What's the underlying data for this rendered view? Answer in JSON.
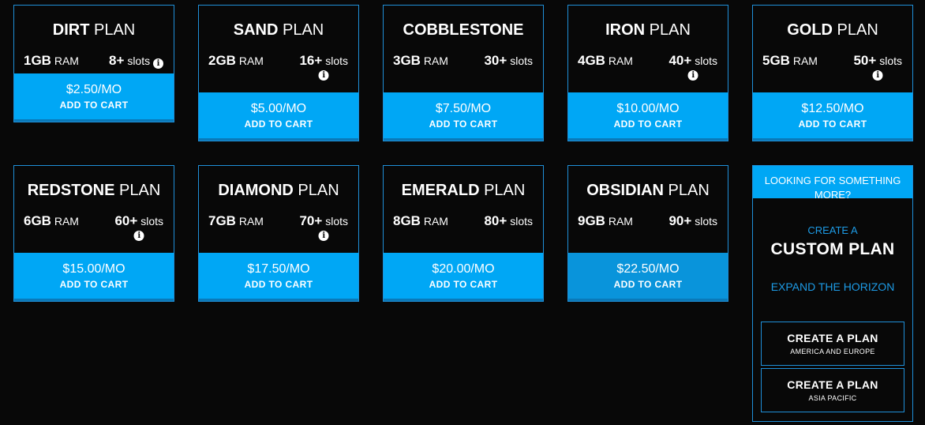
{
  "plans": [
    {
      "name_strong": "DIRT",
      "name_light": "PLAN",
      "ram_num": "1GB",
      "ram_unit": "RAM",
      "slots_num": "8+",
      "slots_unit": "slots",
      "price": "$2.50/MO",
      "cart": "ADD TO CART"
    },
    {
      "name_strong": "SAND",
      "name_light": "PLAN",
      "ram_num": "2GB",
      "ram_unit": "RAM",
      "slots_num": "16+",
      "slots_unit": "slots",
      "price": "$5.00/MO",
      "cart": "ADD TO CART"
    },
    {
      "name_strong": "COBBLESTONE",
      "name_light": "",
      "ram_num": "3GB",
      "ram_unit": "RAM",
      "slots_num": "30+",
      "slots_unit": "slots",
      "price": "$7.50/MO",
      "cart": "ADD TO CART"
    },
    {
      "name_strong": "IRON",
      "name_light": "PLAN",
      "ram_num": "4GB",
      "ram_unit": "RAM",
      "slots_num": "40+",
      "slots_unit": "slots",
      "price": "$10.00/MO",
      "cart": "ADD TO CART"
    },
    {
      "name_strong": "GOLD",
      "name_light": "PLAN",
      "ram_num": "5GB",
      "ram_unit": "RAM",
      "slots_num": "50+",
      "slots_unit": "slots",
      "price": "$12.50/MO",
      "cart": "ADD TO CART"
    },
    {
      "name_strong": "REDSTONE",
      "name_light": "PLAN",
      "ram_num": "6GB",
      "ram_unit": "RAM",
      "slots_num": "60+",
      "slots_unit": "slots",
      "price": "$15.00/MO",
      "cart": "ADD TO CART"
    },
    {
      "name_strong": "DIAMOND",
      "name_light": "PLAN",
      "ram_num": "7GB",
      "ram_unit": "RAM",
      "slots_num": "70+",
      "slots_unit": "slots",
      "price": "$17.50/MO",
      "cart": "ADD TO CART"
    },
    {
      "name_strong": "EMERALD",
      "name_light": "PLAN",
      "ram_num": "8GB",
      "ram_unit": "RAM",
      "slots_num": "80+",
      "slots_unit": "slots",
      "price": "$20.00/MO",
      "cart": "ADD TO CART"
    },
    {
      "name_strong": "OBSIDIAN",
      "name_light": "PLAN",
      "ram_num": "9GB",
      "ram_unit": "RAM",
      "slots_num": "90+",
      "slots_unit": "slots",
      "price": "$22.50/MO",
      "cart": "ADD TO CART"
    }
  ],
  "info_icon": {
    "icon": "info-icon",
    "glyph": "i"
  },
  "custom": {
    "header": "LOOKING FOR SOMETHING MORE?",
    "sub": "CREATE A",
    "title": "CUSTOM PLAN",
    "expand": "EXPAND THE HORIZON",
    "buttons": [
      {
        "title": "CREATE A PLAN",
        "region": "AMERICA AND EUROPE"
      },
      {
        "title": "CREATE A PLAN",
        "region": "ASIA PACIFIC"
      }
    ]
  },
  "colors": {
    "accent": "#00a7f5",
    "border": "#1f8fd8",
    "background": "#080808",
    "link": "#1d9be6"
  }
}
